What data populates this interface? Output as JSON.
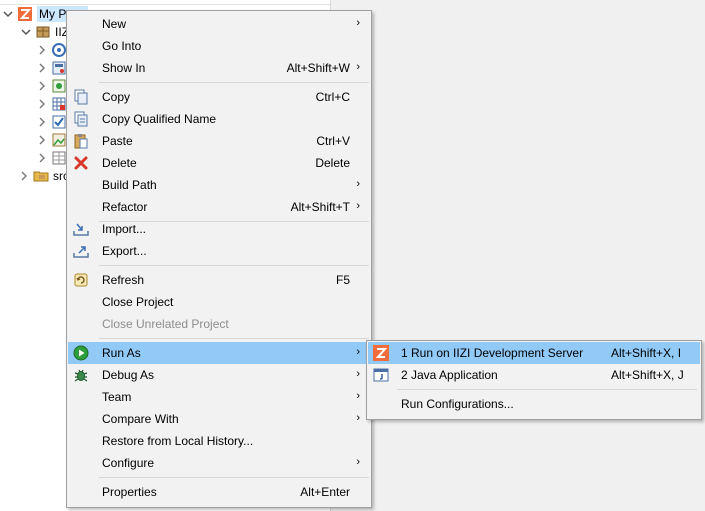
{
  "tree": {
    "project_label": "My Pr",
    "child_label": "IIZ",
    "src_label": "src"
  },
  "menu": {
    "items": [
      {
        "label": "New",
        "accel": "",
        "submenu": true
      },
      {
        "label": "Go Into",
        "accel": ""
      },
      {
        "label": "Show In",
        "accel": "Alt+Shift+W",
        "submenu": true
      },
      {
        "label": "Copy",
        "accel": "Ctrl+C"
      },
      {
        "label": "Copy Qualified Name",
        "accel": ""
      },
      {
        "label": "Paste",
        "accel": "Ctrl+V"
      },
      {
        "label": "Delete",
        "accel": "Delete"
      },
      {
        "label": "Build Path",
        "accel": "",
        "submenu": true
      },
      {
        "label": "Refactor",
        "accel": "Alt+Shift+T",
        "submenu": true
      },
      {
        "label": "Import...",
        "accel": ""
      },
      {
        "label": "Export...",
        "accel": ""
      },
      {
        "label": "Refresh",
        "accel": "F5"
      },
      {
        "label": "Close Project",
        "accel": ""
      },
      {
        "label": "Close Unrelated Project",
        "accel": "",
        "disabled": true
      },
      {
        "label": "Run As",
        "accel": "",
        "submenu": true,
        "highlighted": true
      },
      {
        "label": "Debug As",
        "accel": "",
        "submenu": true
      },
      {
        "label": "Team",
        "accel": "",
        "submenu": true
      },
      {
        "label": "Compare With",
        "accel": "",
        "submenu": true
      },
      {
        "label": "Restore from Local History...",
        "accel": ""
      },
      {
        "label": "Configure",
        "accel": "",
        "submenu": true
      },
      {
        "label": "Properties",
        "accel": "Alt+Enter"
      }
    ],
    "arrow_glyph": "›"
  },
  "run_as_submenu": {
    "items": [
      {
        "label": "1 Run on IIZI Development Server",
        "accel": "Alt+Shift+X, I",
        "highlighted": true
      },
      {
        "label": "2 Java Application",
        "accel": "Alt+Shift+X, J"
      },
      {
        "label": "Run Configurations...",
        "accel": ""
      }
    ]
  },
  "colors": {
    "highlight": "#91c9f7",
    "menu_bg": "#f2f2f2",
    "iizi_orange": "#f26b3a",
    "delete_red": "#d9372b",
    "run_green": "#2e9e3c"
  }
}
